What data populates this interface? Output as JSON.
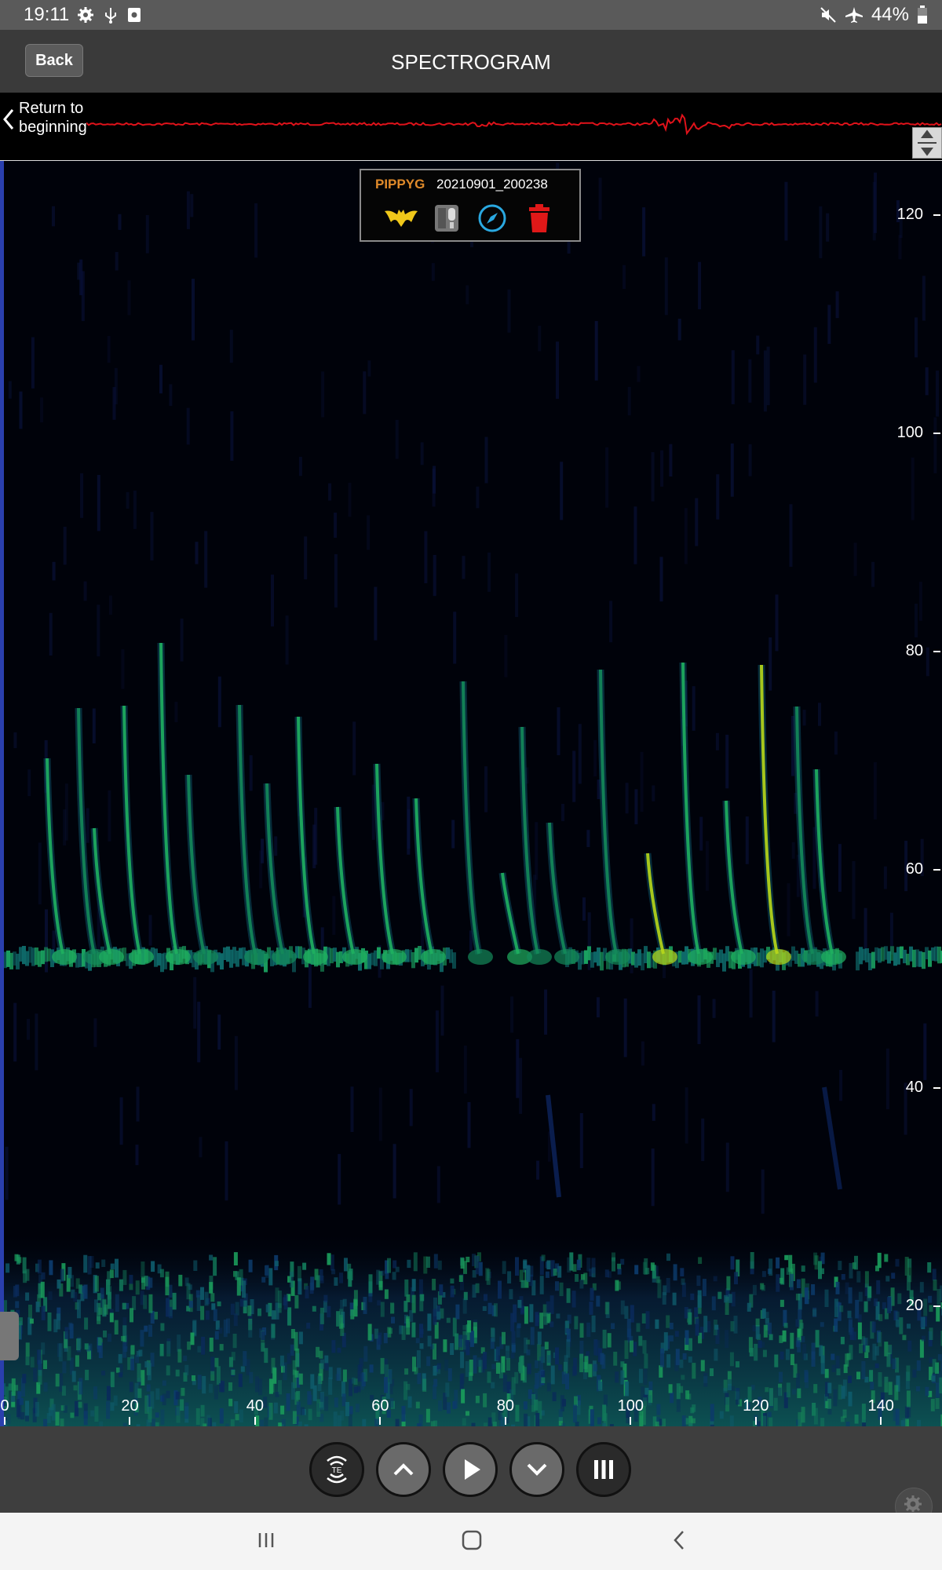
{
  "status_bar": {
    "time": "19:11",
    "battery": "44%",
    "left_icons": [
      "gear-icon",
      "usb-icon",
      "screenshot-icon"
    ],
    "right_icons": [
      "mute-icon",
      "airplane-icon",
      "battery-icon"
    ]
  },
  "header": {
    "back_label": "Back",
    "title": "SPECTROGRAM"
  },
  "waveform": {
    "return_label_line1": "Return to",
    "return_label_line2": "beginning",
    "wave_color": "#e0121a"
  },
  "recording": {
    "species": "PIPPYG",
    "filename": "20210901_200238",
    "species_color": "#e08a2a",
    "icons": [
      "bat-icon",
      "recorder-icon",
      "compass-icon",
      "trash-icon"
    ]
  },
  "chart_data": {
    "type": "heatmap",
    "y_ticks": [
      "120",
      "100",
      "80",
      "60",
      "40",
      "20"
    ],
    "x_ticks": [
      "0",
      "20",
      "40",
      "60",
      "80",
      "100",
      "120",
      "140"
    ],
    "ylim": [
      9,
      125
    ],
    "xlim": [
      0,
      149
    ],
    "colors": {
      "background": "#00020a",
      "low": "#0a3a6a",
      "mid": "#1aa060",
      "high": "#c8e020"
    }
  },
  "controls": {
    "buttons": [
      "te-button",
      "up-button",
      "play-button",
      "down-button",
      "pause-button"
    ]
  },
  "navbar": {
    "buttons": [
      "recents-button",
      "home-button",
      "nav-back-button"
    ]
  }
}
